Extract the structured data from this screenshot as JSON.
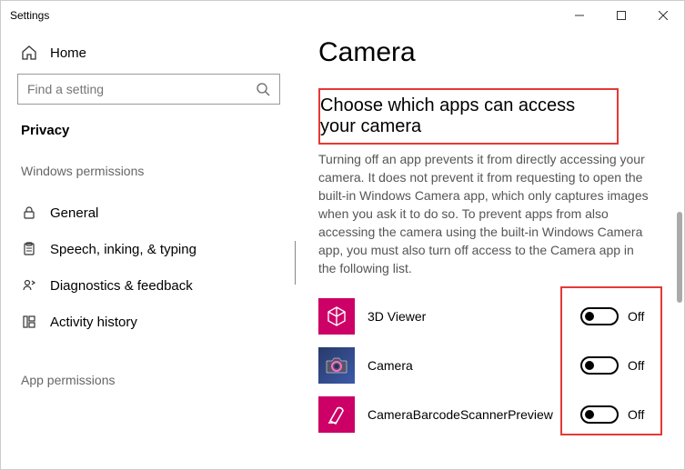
{
  "window": {
    "title": "Settings"
  },
  "sidebar": {
    "home": "Home",
    "search_placeholder": "Find a setting",
    "category": "Privacy",
    "section1": "Windows permissions",
    "items": [
      {
        "label": "General"
      },
      {
        "label": "Speech, inking, & typing"
      },
      {
        "label": "Diagnostics & feedback"
      },
      {
        "label": "Activity history"
      }
    ],
    "section2": "App permissions"
  },
  "main": {
    "title": "Camera",
    "subtitle": "Choose which apps can access your camera",
    "description": "Turning off an app prevents it from directly accessing your camera. It does not prevent it from requesting to open the built-in Windows Camera app, which only captures images when you ask it to do so. To prevent apps from also accessing the camera using the built-in Windows Camera app, you must also turn off access to the Camera app in the following list.",
    "apps": [
      {
        "label": "3D Viewer",
        "state": "Off"
      },
      {
        "label": "Camera",
        "state": "Off"
      },
      {
        "label": "CameraBarcodeScannerPreview",
        "state": "Off"
      }
    ]
  }
}
